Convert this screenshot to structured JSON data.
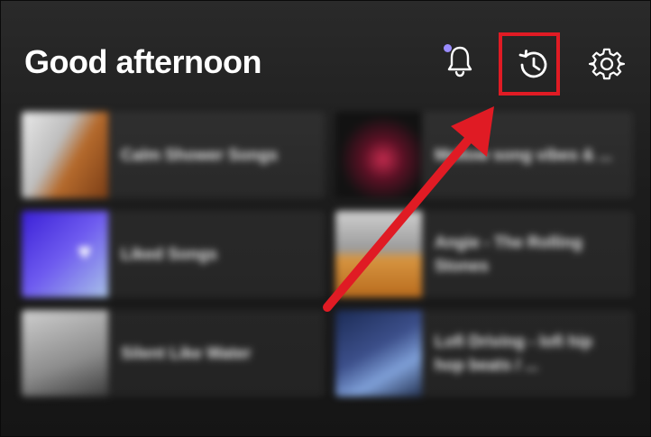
{
  "header": {
    "greeting": "Good afternoon",
    "icons": {
      "notifications": "bell-icon",
      "recently_played": "history-icon",
      "settings": "gear-icon"
    },
    "notification_dot_color": "#9a8cff"
  },
  "annotation": {
    "color": "#e01b24",
    "target": "recently-played"
  },
  "shortcuts": [
    {
      "title": "Calm Shower Songs"
    },
    {
      "title": "Mellow song vibes & ..."
    },
    {
      "title": "Liked Songs"
    },
    {
      "title": "Angie - The Rolling Stones"
    },
    {
      "title": "Silent Like Water"
    },
    {
      "title": "Lofi Driving - lofi hip hop beats / ..."
    }
  ]
}
